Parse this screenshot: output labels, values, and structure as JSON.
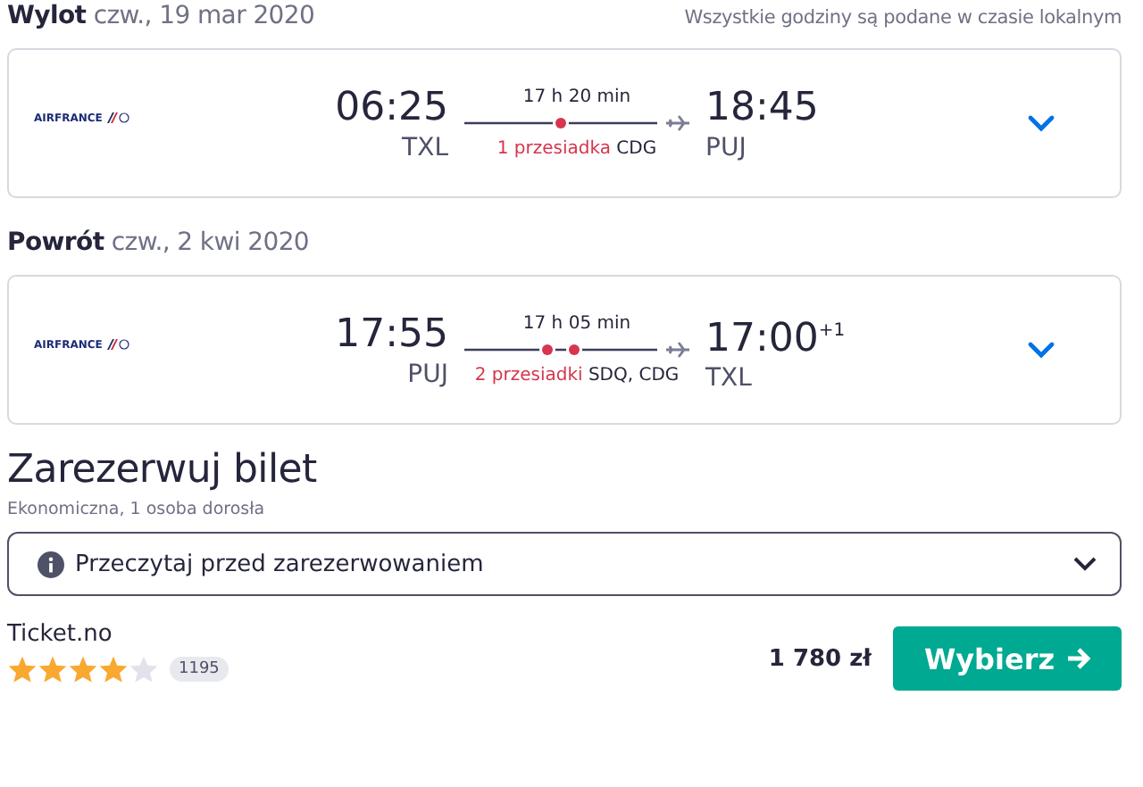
{
  "note": "Wszystkie godziny są podane w czasie lokalnym",
  "legs": [
    {
      "label": "Wylot",
      "date": "czw., 19 mar 2020",
      "airline": "AIRFRANCE",
      "dep_time": "06:25",
      "dep_code": "TXL",
      "duration": "17 h 20 min",
      "stops_label": "1 przesiadka",
      "stops": [
        "CDG"
      ],
      "arr_time": "18:45",
      "arr_code": "PUJ",
      "expanded": false
    },
    {
      "label": "Powrót",
      "date": "czw., 2 kwi 2020",
      "airline": "AIRFRANCE",
      "dep_time": "17:55",
      "dep_code": "PUJ",
      "duration": "17 h 05 min",
      "stops_label": "2 przesiadki",
      "stops": [
        "SDQ,",
        "CDG"
      ],
      "arr_time": "17:00",
      "arr_days": "+1",
      "arr_code": "TXL",
      "expanded": false
    }
  ],
  "booking": {
    "title": "Zarezerwuj bilet",
    "subtitle": "Ekonomiczna, 1 osoba dorosła",
    "info": "Przeczytaj przed zarezerwowaniem",
    "info_expanded": false,
    "provider": "Ticket.no",
    "stars": 4,
    "reviews": "1195",
    "price": "1 780 zł",
    "button": "Wybierz"
  }
}
